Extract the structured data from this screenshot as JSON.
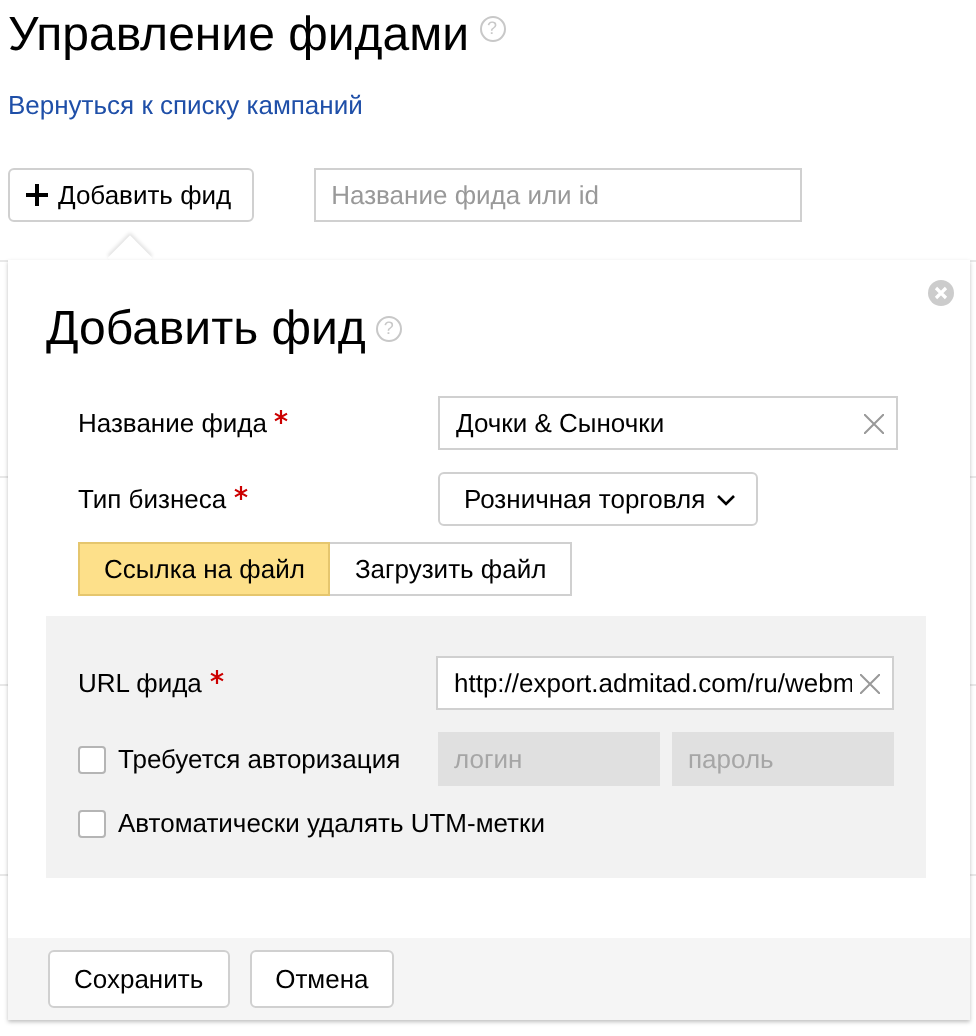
{
  "page": {
    "title": "Управление фидами",
    "help": "?",
    "back_link": "Вернуться к списку кампаний"
  },
  "toolbar": {
    "add_button": "Добавить фид",
    "search": {
      "placeholder": "Название фида или id"
    }
  },
  "popup": {
    "title": "Добавить фид",
    "help": "?",
    "fields": [
      {
        "kind": "text",
        "label": "Название фида",
        "required": true,
        "value": "Дочки & Сыночки"
      },
      {
        "kind": "select",
        "label": "Тип бизнеса",
        "required": true,
        "value": "Розничная торговля"
      }
    ],
    "tabs": [
      {
        "label": "Ссылка на файл",
        "selected": true
      },
      {
        "label": "Загрузить файл",
        "selected": false
      }
    ],
    "source": {
      "url_label": "URL фида",
      "url_required": true,
      "url_value": "http://export.admitad.com/ru/webm",
      "auth": {
        "label": "Требуется авторизация",
        "checked": false,
        "login": {
          "placeholder": "логин",
          "disabled": true
        },
        "password": {
          "placeholder": "пароль",
          "disabled": true
        }
      },
      "utm": {
        "label": "Автоматически удалять UTM-метки",
        "checked": false
      }
    },
    "buttons": [
      "Сохранить",
      "Отмена"
    ]
  }
}
